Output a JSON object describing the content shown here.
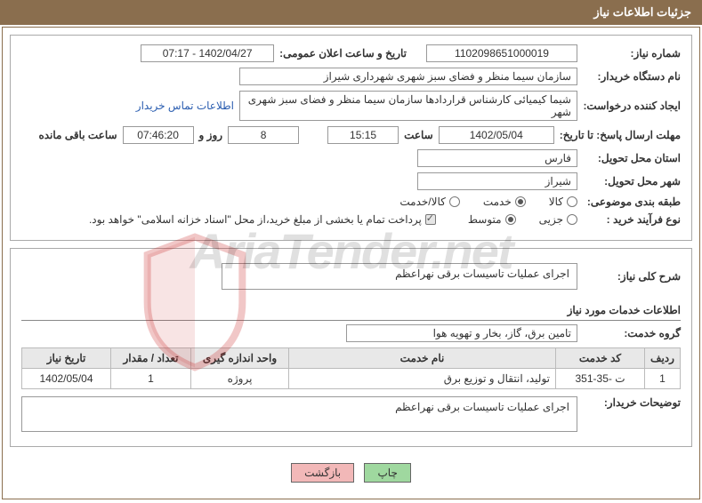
{
  "header": {
    "title": "جزئیات اطلاعات نیاز"
  },
  "watermark": "AriaTender.net",
  "panel1": {
    "need_no_label": "شماره نیاز:",
    "need_no": "1102098651000019",
    "announce_label": "تاریخ و ساعت اعلان عمومی:",
    "announce": "1402/04/27 - 07:17",
    "buyer_label": "نام دستگاه خریدار:",
    "buyer": "سازمان سیما منظر و فضای سبز شهری شهرداری شیراز",
    "requester_label": "ایجاد کننده درخواست:",
    "requester": "شیما کیمیائی کارشناس قراردادها سازمان سیما منظر و فضای سبز شهری شهر",
    "contact_link": "اطلاعات تماس خریدار",
    "deadline_label": "مهلت ارسال پاسخ: تا تاریخ:",
    "deadline_date": "1402/05/04",
    "time_label": "ساعت",
    "deadline_time": "15:15",
    "days": "8",
    "days_label": "روز و",
    "remaining_time": "07:46:20",
    "remaining_label": "ساعت باقی مانده",
    "province_label": "استان محل تحویل:",
    "province": "فارس",
    "city_label": "شهر محل تحویل:",
    "city": "شیراز",
    "category_label": "طبقه بندی موضوعی:",
    "cat_goods": "کالا",
    "cat_service": "خدمت",
    "cat_goods_service": "کالا/خدمت",
    "process_label": "نوع فرآیند خرید :",
    "proc_minor": "جزیی",
    "proc_medium": "متوسط",
    "payment_note": "پرداخت تمام یا بخشی از مبلغ خرید،از محل \"اسناد خزانه اسلامی\" خواهد بود."
  },
  "panel2": {
    "summary_label": "شرح کلی نیاز:",
    "summary": "اجرای عملیات تاسیسات برقی نهراعظم",
    "services_title": "اطلاعات خدمات مورد نیاز",
    "group_label": "گروه خدمت:",
    "group": "تامین برق، گاز، بخار و تهویه هوا",
    "table": {
      "headers": [
        "ردیف",
        "کد خدمت",
        "نام خدمت",
        "واحد اندازه گیری",
        "تعداد / مقدار",
        "تاریخ نیاز"
      ],
      "row": {
        "idx": "1",
        "code": "ت -35-351",
        "name": "تولید، انتقال و توزیع برق",
        "unit": "پروژه",
        "qty": "1",
        "date": "1402/05/04"
      }
    },
    "buyer_desc_label": "توضیحات خریدار:",
    "buyer_desc": "اجرای عملیات تاسیسات برقی نهراعظم"
  },
  "buttons": {
    "print": "چاپ",
    "back": "بازگشت"
  }
}
